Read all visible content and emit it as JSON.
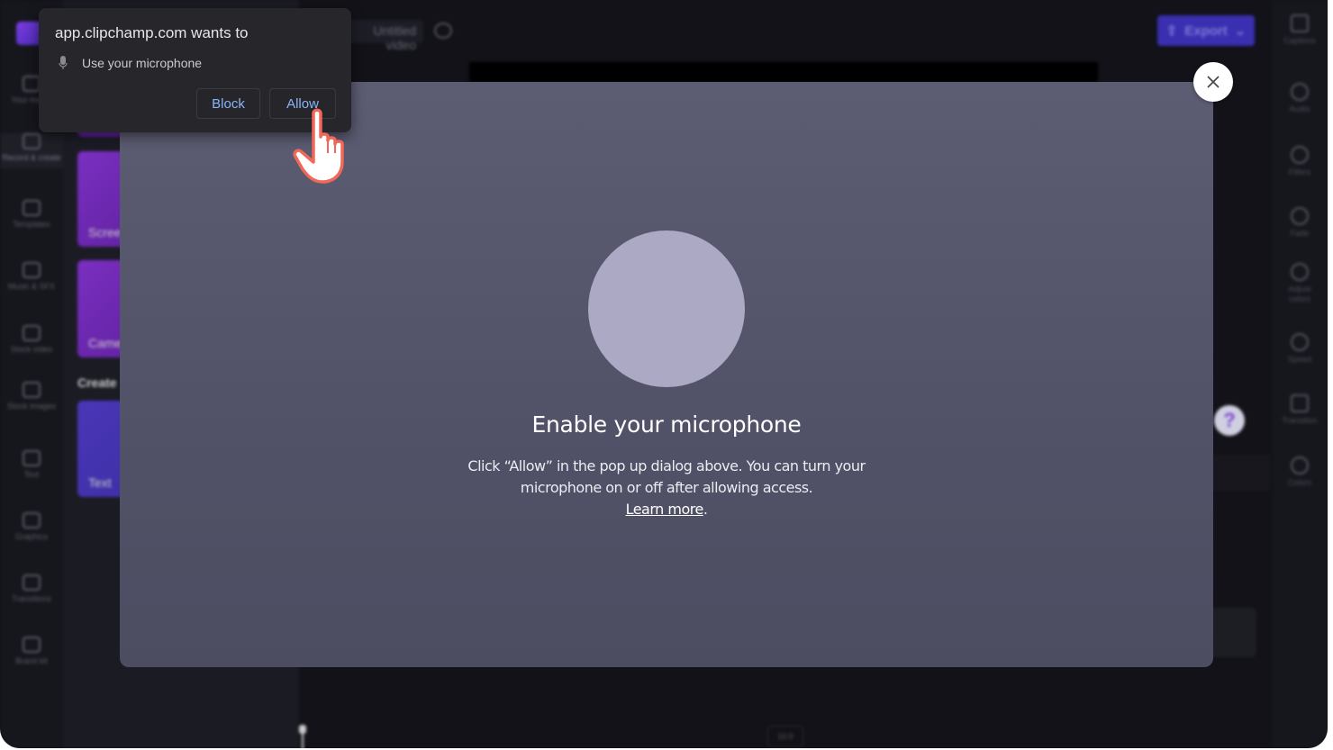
{
  "app": {
    "project_title": "Untitled video",
    "export_label": "Export",
    "aspect_ratio": "16:9",
    "left_nav": [
      "Your media",
      "Record & create",
      "Templates",
      "Music & SFX",
      "Stock video",
      "Stock images",
      "Text",
      "Graphics",
      "Transitions",
      "Brand kit"
    ],
    "panel": {
      "cards": [
        "Screen",
        "Camera",
        "Text"
      ],
      "section_heading": "Create"
    },
    "right_nav": [
      "Captions",
      "Audio",
      "Filters",
      "Fade",
      "Adjust colors",
      "Speed",
      "Transition",
      "Colors"
    ],
    "help_label": "?"
  },
  "modal": {
    "title": "Enable your microphone",
    "body": "Click “Allow” in the pop up dialog above.  You can turn your microphone on or off after allowing access.",
    "link": "Learn more",
    "link_suffix": "."
  },
  "permission_prompt": {
    "title": "app.clipchamp.com wants to",
    "permission": "Use your microphone",
    "block_label": "Block",
    "allow_label": "Allow"
  },
  "colors": {
    "accent_link": "#8ab4f8",
    "modal_bg": "#56566c",
    "export": "#3a2fb0",
    "cursor_outline": "#f0685a"
  }
}
